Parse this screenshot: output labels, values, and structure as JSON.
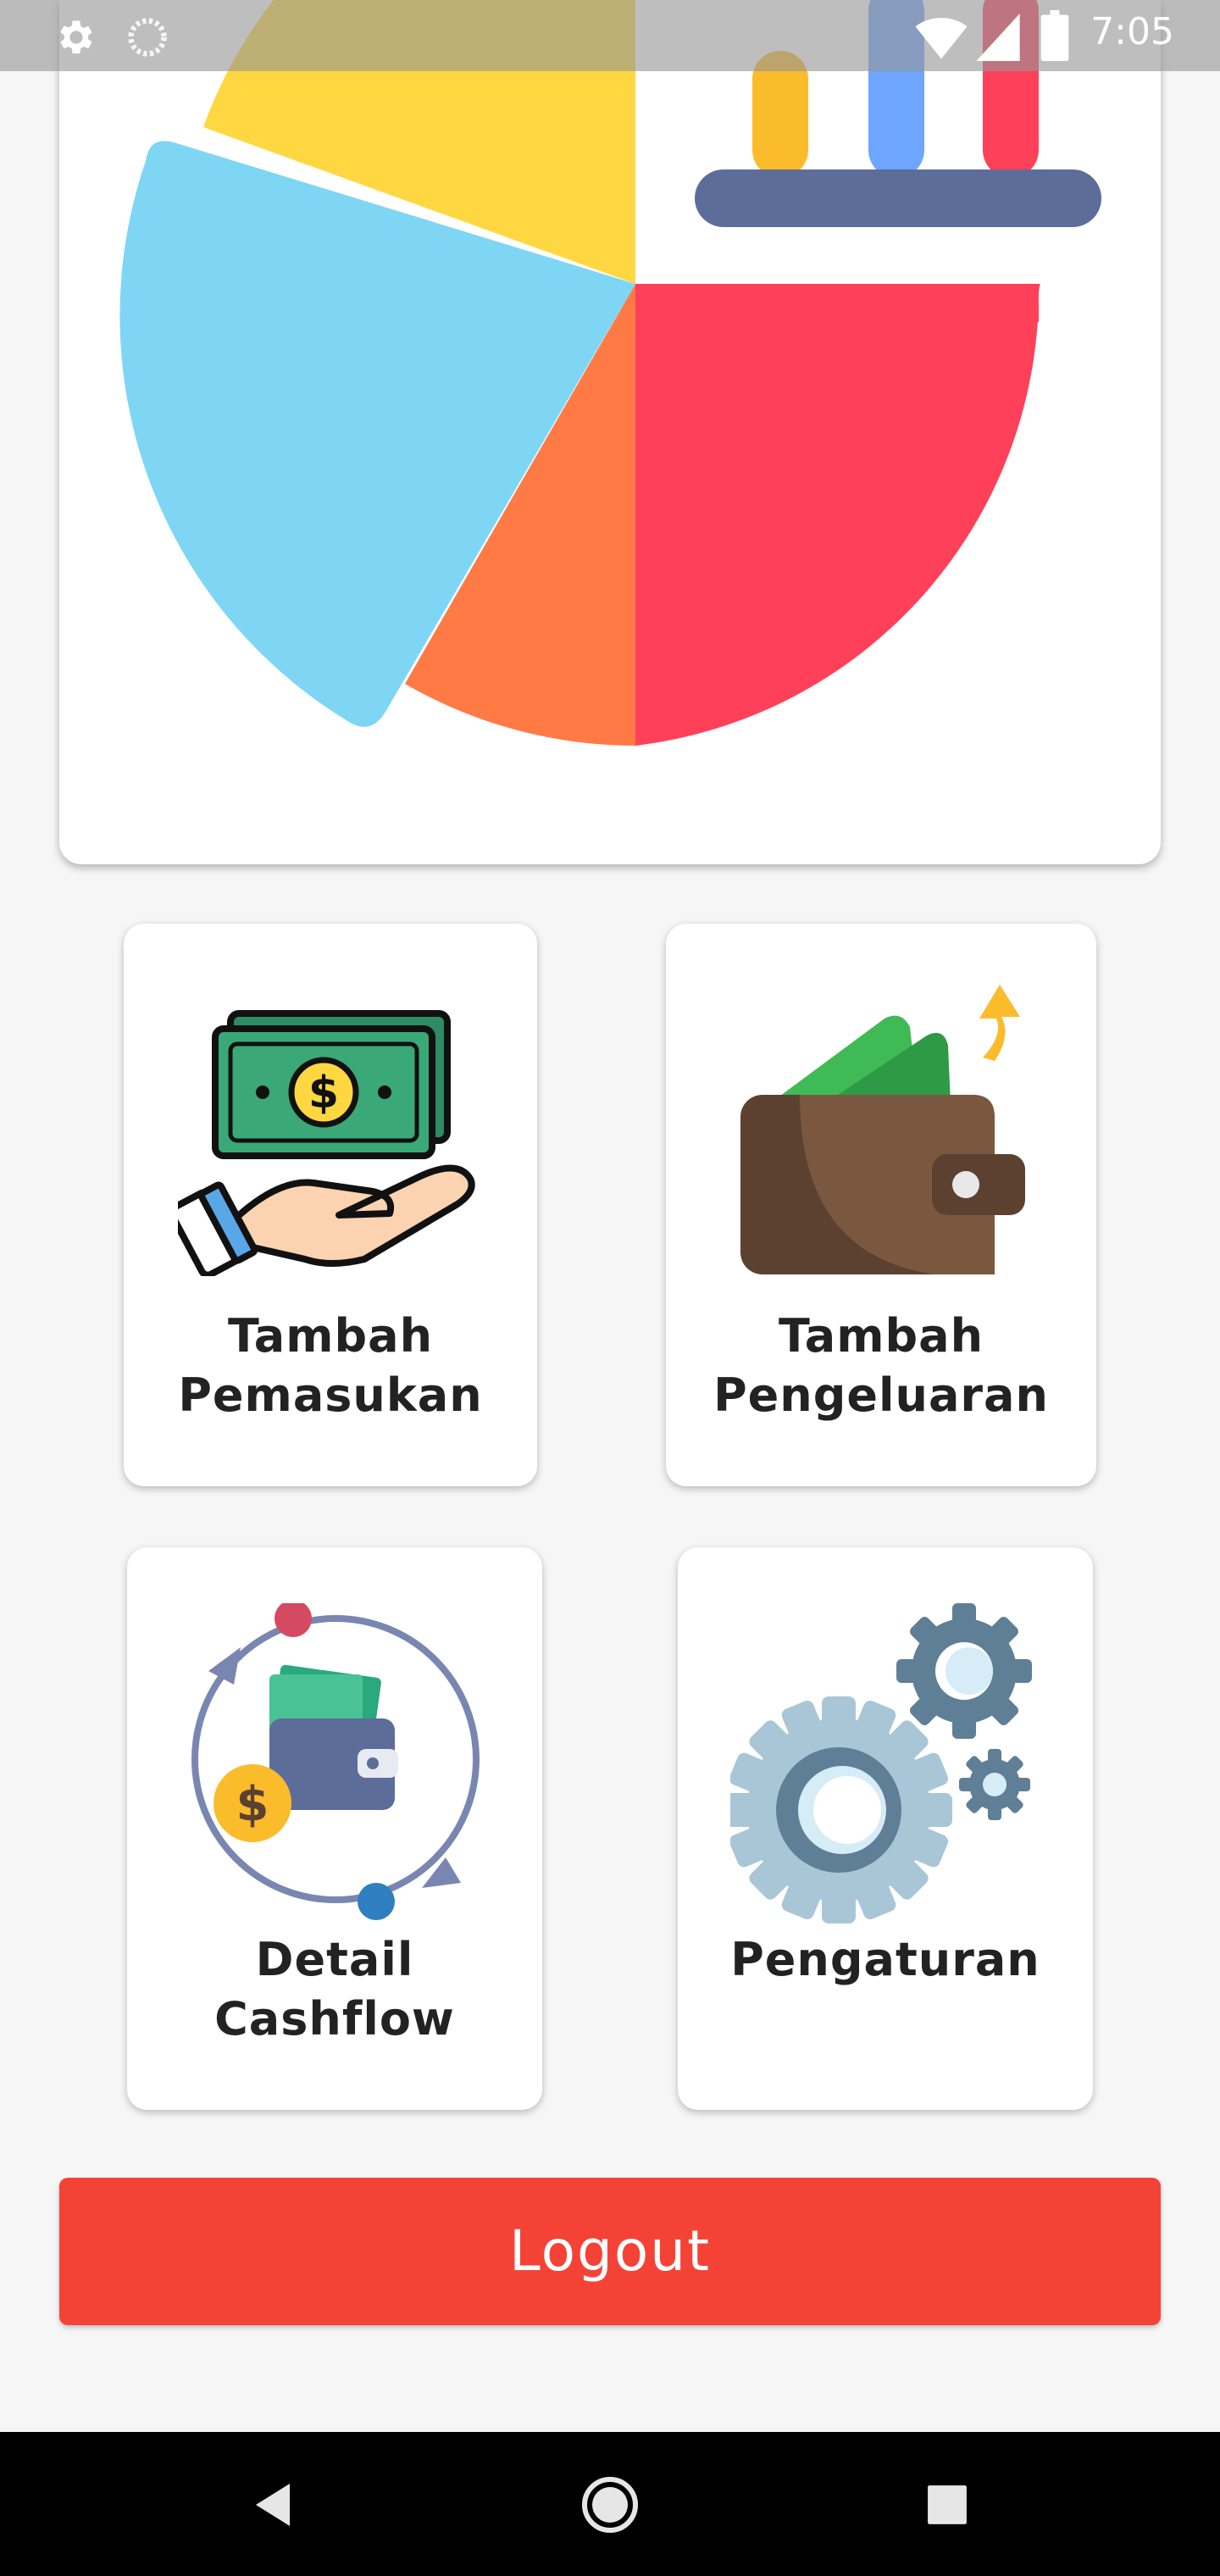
{
  "status_bar": {
    "time": "7:05",
    "icons": [
      "settings-icon",
      "loading-icon",
      "wifi-icon",
      "signal-icon",
      "battery-icon"
    ]
  },
  "hero": {
    "illustration": "pie-chart-with-bar-chart-illustration",
    "colors": [
      "#ffd740",
      "#7fd6f4",
      "#ff7a45",
      "#ff4059",
      "#5d6d9a",
      "#fbbc2c",
      "#6ea5ff"
    ]
  },
  "menu": {
    "tiles": [
      {
        "line1": "Tambah",
        "line2": "Pemasukan",
        "icon": "money-hand-icon"
      },
      {
        "line1": "Tambah",
        "line2": "Pengeluaran",
        "icon": "wallet-icon"
      },
      {
        "line1": "Detail",
        "line2": "Cashflow",
        "icon": "cashflow-icon"
      },
      {
        "line1": "Pengaturan",
        "line2": "",
        "icon": "gears-icon"
      }
    ]
  },
  "logout": {
    "label": "Logout",
    "color": "#f44336"
  },
  "navigation": {
    "buttons": [
      "back-icon",
      "home-icon",
      "recents-icon"
    ]
  }
}
